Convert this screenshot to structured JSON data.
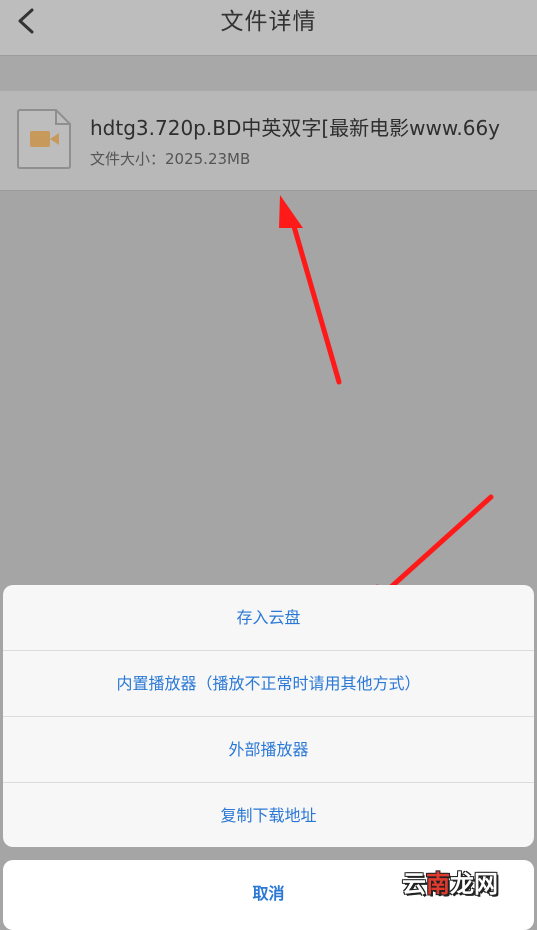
{
  "header": {
    "title": "文件详情",
    "back_icon": "chevron-left-icon"
  },
  "file": {
    "name": "hdtg3.720p.BD中英双字[最新电影www.66y",
    "size": "文件大小：2025.23MB",
    "icon": "video-file-icon"
  },
  "action_sheet": {
    "items": [
      {
        "label": "存入云盘"
      },
      {
        "label": "内置播放器（播放不正常时请用其他方式）"
      },
      {
        "label": "外部播放器"
      },
      {
        "label": "复制下载地址"
      }
    ],
    "cancel_label": "取消"
  },
  "watermark": {
    "left": "云",
    "accent": "南",
    "right": "龙网"
  },
  "colors": {
    "overlay": "#a5a5a5",
    "accent": "#2a78d6",
    "annotation_arrow": "#ff1a1a",
    "file_icon": "#c79a5c"
  }
}
